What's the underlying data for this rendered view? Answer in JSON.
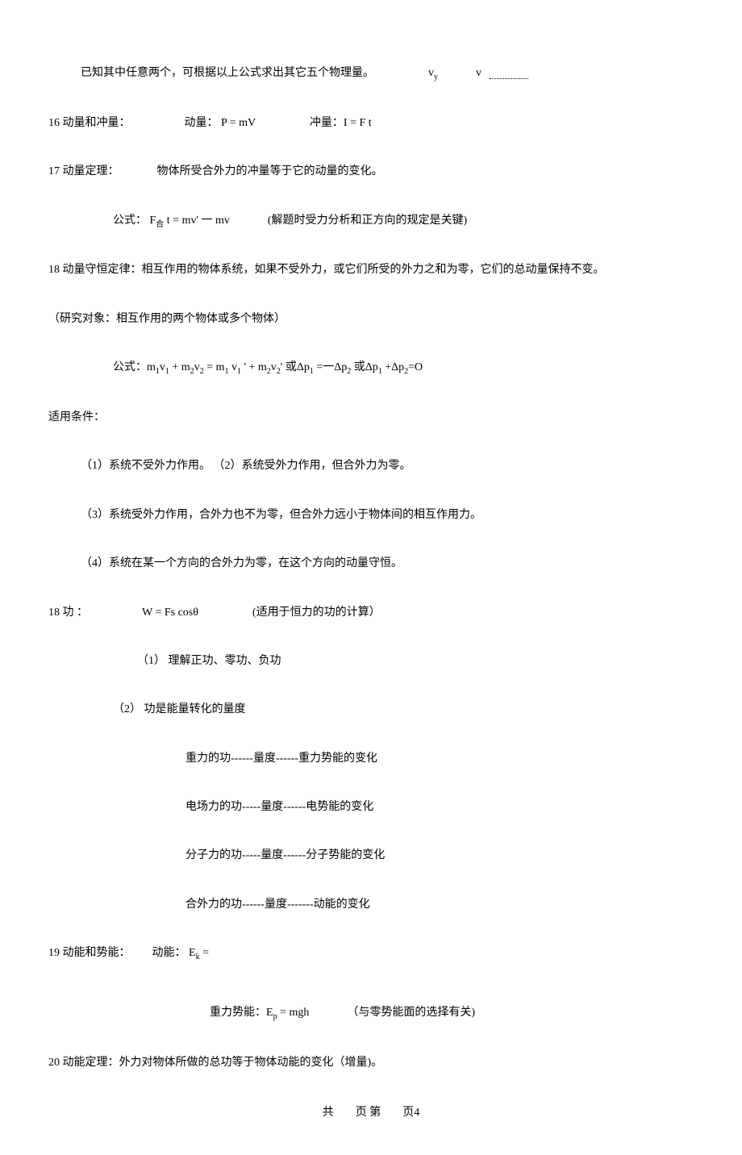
{
  "lines": {
    "l1_pre": "已知其中任意两个，可根据以上公式求出其它五个物理量。",
    "l1_vy": "v",
    "l1_vy_sub": "y",
    "l1_v": "v",
    "l2": "16 动量和冲量：",
    "l2_b": "动量： P = mV",
    "l2_c": "冲量：I = F t",
    "l3": "17 动量定理：",
    "l3_b": "物体所受合外力的冲量等于它的动量的变化。",
    "l4_a": "公式：  F",
    "l4_sub": "合",
    "l4_b": " t = mv' 一 mv",
    "l4_c": "(解题时受力分析和正方向的规定是关键)",
    "l5": "18 动量守恒定律：相互作用的物体系统，如果不受外力，或它们所受的外力之和为零，它们的总动量保持不变。",
    "l6": "（研究对象：相互作用的两个物体或多个物体）",
    "l7_a": "公式：m",
    "l7_b": "v",
    "l7_c": "   + m",
    "l7_d": "v",
    "l7_e": " = m",
    "l7_f": " v",
    "l7_g": " ' + m",
    "l7_h": "v",
    "l7_i": "'  或Δp",
    "l7_j": " =一Δp",
    "l7_k": "    或Δp",
    "l7_l": " +Δp",
    "l7_m": "=O",
    "l8": "适用条件：",
    "l9": "（1）系统不受外力作用。  （2）系统受外力作用，但合外力为零。",
    "l10": "（3）系统受外力作用，合外力也不为零，但合外力远小于物体间的相互作用力。",
    "l11": "（4）系统在某一个方向的合外力为零，在这个方向的动量守恒。",
    "l12_a": "18  功 ：",
    "l12_b": "W = Fs cosθ",
    "l12_c": "(适用于恒力的功的计算）",
    "l13": "（1）   理解正功、零功、负功",
    "l14": "（2）   功是能量转化的量度",
    "l15": "重力的功------量度------重力势能的变化",
    "l16": "电场力的功-----量度------电势能的变化",
    "l17": "分子力的功-----量度------分子势能的变化",
    "l18": "合外力的功------量度-------动能的变化",
    "l19_a": "19   动能和势能：",
    "l19_b": "动能： E",
    "l19_b_sub": "k",
    "l19_c": " =",
    "l20_a": "重力势能：E",
    "l20_a_sub": "p",
    "l20_b": " = mgh",
    "l20_c": "（与零势能面的选择有关)",
    "l21": "20   动能定理：外力对物体所做的总功等于物体动能的变化（增量)。",
    "footer_a": "共",
    "footer_b": "页  第",
    "footer_c": "页4"
  }
}
